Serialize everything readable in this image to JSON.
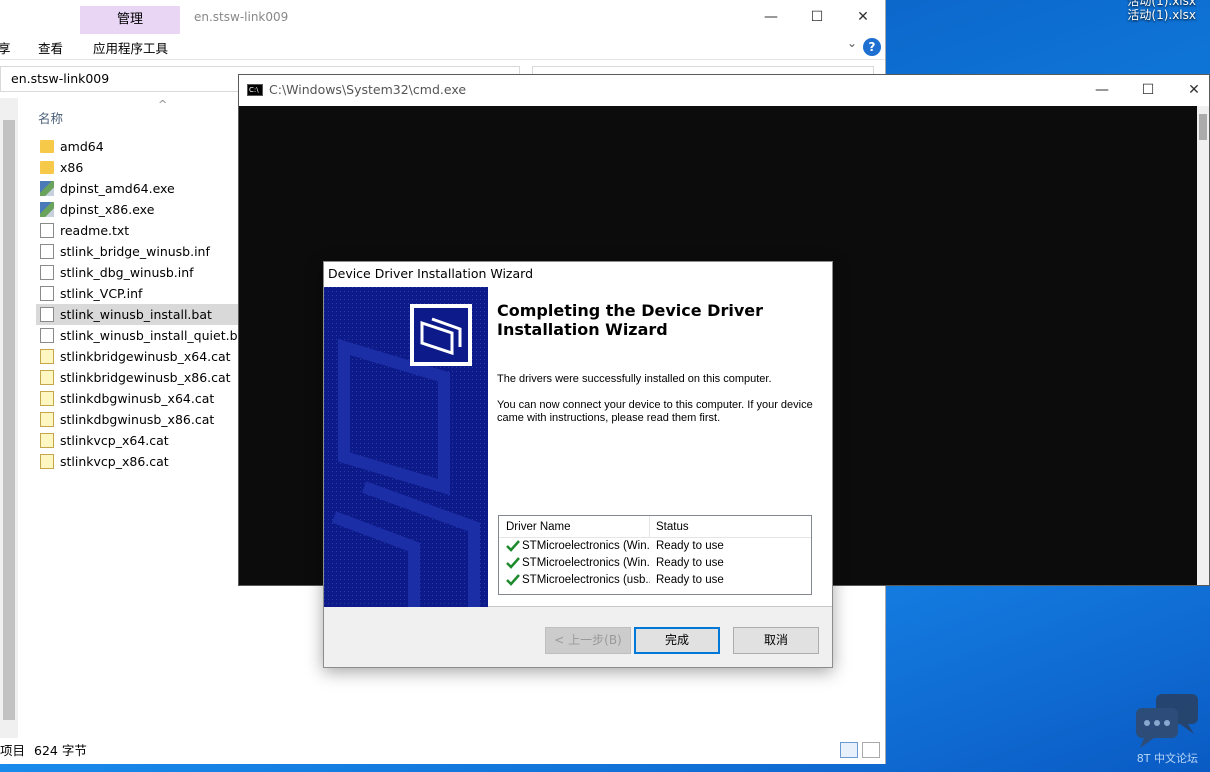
{
  "desktop": {
    "file_label": "活动(1).xlsx",
    "file_label_top": "活动(1).xlsx",
    "watermark": "8T 中文论坛"
  },
  "explorer": {
    "context_tab": "管理",
    "title": "en.stsw-link009",
    "tabs": [
      "享",
      "查看",
      "应用程序工具"
    ],
    "address": "en.stsw-link009",
    "column_name": "名称",
    "files": [
      {
        "name": "amd64",
        "icon": "folder-icon"
      },
      {
        "name": "x86",
        "icon": "folder-icon"
      },
      {
        "name": "dpinst_amd64.exe",
        "icon": "installer-icon"
      },
      {
        "name": "dpinst_x86.exe",
        "icon": "installer-icon"
      },
      {
        "name": "readme.txt",
        "icon": "text-file-icon"
      },
      {
        "name": "stlink_bridge_winusb.inf",
        "icon": "inf-file-icon"
      },
      {
        "name": "stlink_dbg_winusb.inf",
        "icon": "inf-file-icon"
      },
      {
        "name": "stlink_VCP.inf",
        "icon": "inf-file-icon"
      },
      {
        "name": "stlink_winusb_install.bat",
        "icon": "batch-file-icon"
      },
      {
        "name": "stlink_winusb_install_quiet.bat",
        "icon": "batch-file-icon"
      },
      {
        "name": "stlinkbridgewinusb_x64.cat",
        "icon": "catalog-file-icon"
      },
      {
        "name": "stlinkbridgewinusb_x86.cat",
        "icon": "catalog-file-icon"
      },
      {
        "name": "stlinkdbgwinusb_x64.cat",
        "icon": "catalog-file-icon"
      },
      {
        "name": "stlinkdbgwinusb_x86.cat",
        "icon": "catalog-file-icon"
      },
      {
        "name": "stlinkvcp_x64.cat",
        "icon": "catalog-file-icon"
      },
      {
        "name": "stlinkvcp_x86.cat",
        "icon": "catalog-file-icon"
      }
    ],
    "selected_file": "stlink_winusb_install.bat",
    "status_items": "项目",
    "status_size": "624 字节"
  },
  "cmd": {
    "title": "C:\\Windows\\System32\\cmd.exe"
  },
  "wizard": {
    "title": "Device Driver Installation Wizard",
    "heading": "Completing the Device Driver Installation Wizard",
    "text1": "The drivers were successfully installed on this computer.",
    "text2": "You can now connect your device to this computer. If your device came with instructions, please read them first.",
    "col_driver": "Driver Name",
    "col_status": "Status",
    "drivers": [
      {
        "name": "STMicroelectronics (Win...",
        "status": "Ready to use"
      },
      {
        "name": "STMicroelectronics (Win...",
        "status": "Ready to use"
      },
      {
        "name": "STMicroelectronics (usb...",
        "status": "Ready to use"
      }
    ],
    "back_label": "< 上一步(B)",
    "finish_label": "完成",
    "cancel_label": "取消"
  },
  "colors": {
    "wizard_banner": "#0d1a8a",
    "ribbon_context": "#e8d6f4",
    "check": "#1e8a2e",
    "default_button_border": "#0078d7"
  }
}
